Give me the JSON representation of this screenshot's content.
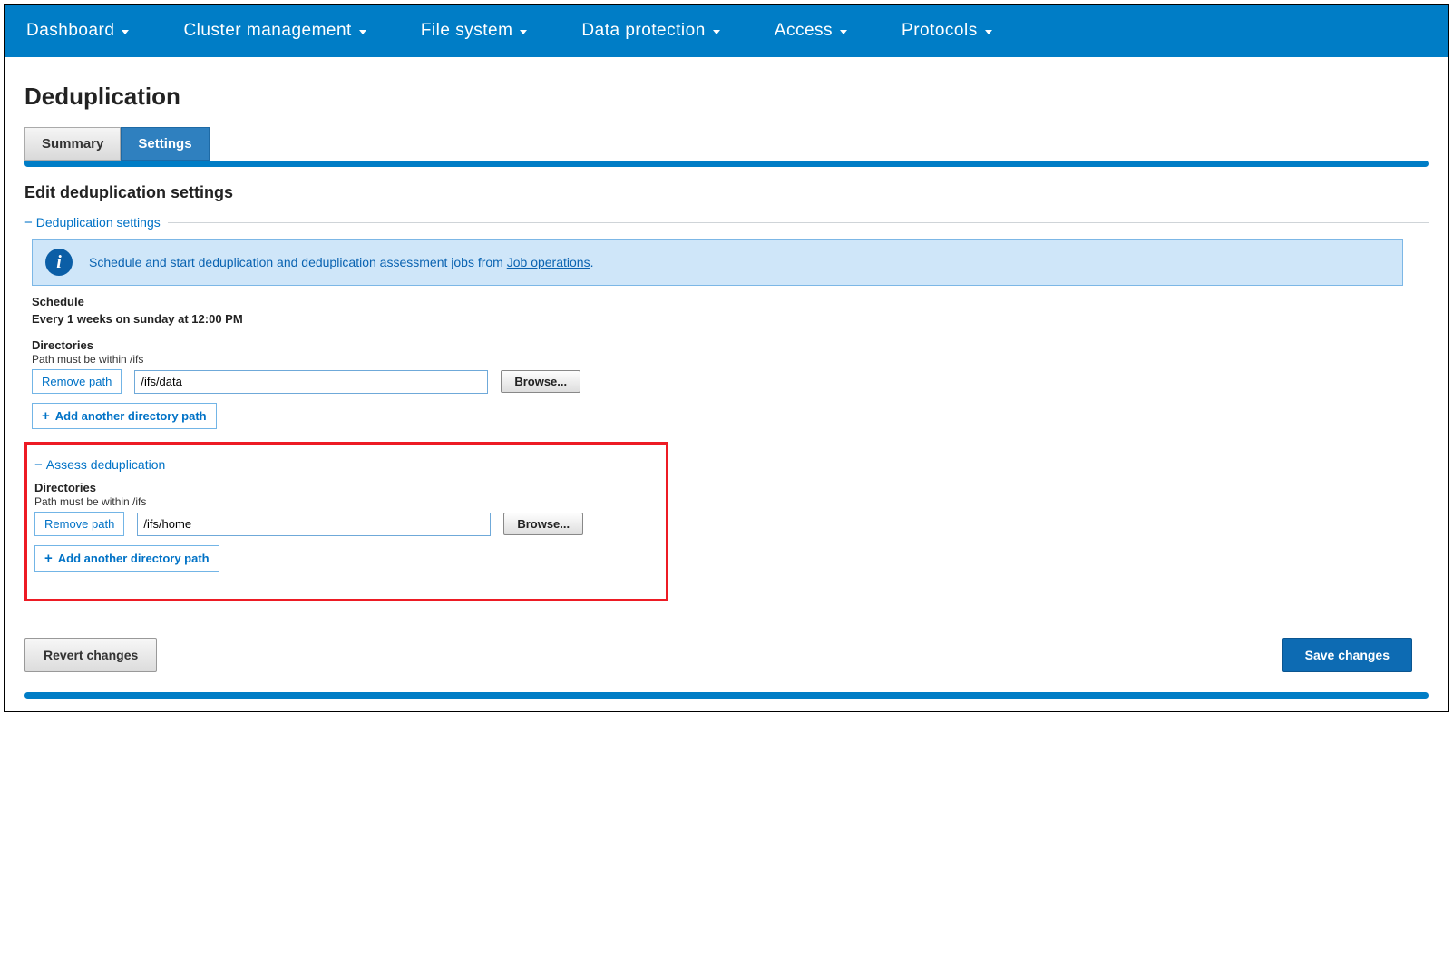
{
  "nav": {
    "items": [
      {
        "label": "Dashboard"
      },
      {
        "label": "Cluster management"
      },
      {
        "label": "File system"
      },
      {
        "label": "Data protection"
      },
      {
        "label": "Access"
      },
      {
        "label": "Protocols"
      }
    ]
  },
  "page": {
    "title": "Deduplication",
    "tabs": [
      {
        "label": "Summary",
        "active": false
      },
      {
        "label": "Settings",
        "active": true
      }
    ],
    "section_title": "Edit deduplication settings"
  },
  "dedup_settings": {
    "legend": "Deduplication settings",
    "info_prefix": "Schedule and start deduplication and deduplication assessment jobs from ",
    "info_link": "Job operations",
    "info_suffix": ".",
    "schedule_label": "Schedule",
    "schedule_value": "Every 1 weeks on sunday at 12:00 PM",
    "directories_label": "Directories",
    "directories_hint": "Path must be within /ifs",
    "remove_label": "Remove path",
    "path_value": "/ifs/data",
    "browse_label": "Browse...",
    "add_label": "Add another directory path"
  },
  "assess": {
    "legend": "Assess deduplication",
    "directories_label": "Directories",
    "directories_hint": "Path must be within /ifs",
    "remove_label": "Remove path",
    "path_value": "/ifs/home",
    "browse_label": "Browse...",
    "add_label": "Add another directory path"
  },
  "footer": {
    "revert": "Revert changes",
    "save": "Save changes"
  }
}
